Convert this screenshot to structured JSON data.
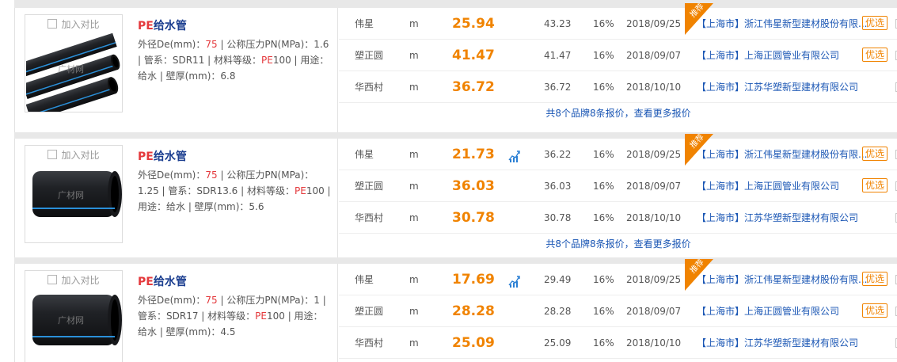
{
  "colors": {
    "price": "#f08300",
    "link": "#1a56b4",
    "highlight": "#e4393c",
    "recommend_badge": "#f08300"
  },
  "products": [
    {
      "compare_label": "加入对比",
      "title_prefix": "PE",
      "title_rest": "给水管",
      "image_watermark": "广材网",
      "specs": {
        "od_label": "外径De(mm)：",
        "od_value": "75",
        "pn_label": " | 公称压力PN(MPa)：1.6 | ",
        "sdr_label": "管系：SDR11 | 材料等级：",
        "material": "PE",
        "tail": "100 | 用途：给水 | 壁厚(mm)：6.8"
      },
      "rows": [
        {
          "brand": "伟星",
          "unit": "m",
          "price": "25.94",
          "trend_icon": false,
          "ref_price": "43.23",
          "tax": "16%",
          "date": "2018/09/25",
          "region": "【上海市】",
          "supplier": "浙江伟星新型建材股份有限...",
          "preferred": "优选",
          "recommended": true
        },
        {
          "brand": "塑正圆",
          "unit": "m",
          "price": "41.47",
          "trend_icon": false,
          "ref_price": "41.47",
          "tax": "16%",
          "date": "2018/09/07",
          "region": "【上海市】",
          "supplier": "上海正圆管业有限公司",
          "preferred": "优选",
          "recommended": false
        },
        {
          "brand": "华西村",
          "unit": "m",
          "price": "36.72",
          "trend_icon": false,
          "ref_price": "36.72",
          "tax": "16%",
          "date": "2018/10/10",
          "region": "【上海市】",
          "supplier": "江苏华塑新型建材有限公司",
          "preferred": "",
          "recommended": false
        }
      ],
      "more_text": "共8个品牌8条报价，查看更多报价"
    },
    {
      "compare_label": "加入对比",
      "title_prefix": "PE",
      "title_rest": "给水管",
      "image_watermark": "广材网",
      "specs": {
        "od_label": "外径De(mm)：",
        "od_value": "75",
        "pn_label": " | 公称压力PN(MPa)：1.25 | ",
        "sdr_label": "管系：SDR13.6 | 材料等级：",
        "material": "PE",
        "tail": "100 | 用途：给水 | 壁厚(mm)：5.6"
      },
      "rows": [
        {
          "brand": "伟星",
          "unit": "m",
          "price": "21.73",
          "trend_icon": true,
          "ref_price": "36.22",
          "tax": "16%",
          "date": "2018/09/25",
          "region": "【上海市】",
          "supplier": "浙江伟星新型建材股份有限...",
          "preferred": "优选",
          "recommended": true
        },
        {
          "brand": "塑正圆",
          "unit": "m",
          "price": "36.03",
          "trend_icon": false,
          "ref_price": "36.03",
          "tax": "16%",
          "date": "2018/09/07",
          "region": "【上海市】",
          "supplier": "上海正圆管业有限公司",
          "preferred": "优选",
          "recommended": false
        },
        {
          "brand": "华西村",
          "unit": "m",
          "price": "30.78",
          "trend_icon": false,
          "ref_price": "30.78",
          "tax": "16%",
          "date": "2018/10/10",
          "region": "【上海市】",
          "supplier": "江苏华塑新型建材有限公司",
          "preferred": "",
          "recommended": false
        }
      ],
      "more_text": "共8个品牌8条报价，查看更多报价"
    },
    {
      "compare_label": "加入对比",
      "title_prefix": "PE",
      "title_rest": "给水管",
      "image_watermark": "广材网",
      "specs": {
        "od_label": "外径De(mm)：",
        "od_value": "75",
        "pn_label": " | 公称压力PN(MPa)：1 | ",
        "sdr_label": "管系：SDR17 | 材料等级：",
        "material": "PE",
        "tail": "100 | 用途：给水 | 壁厚(mm)：4.5"
      },
      "rows": [
        {
          "brand": "伟星",
          "unit": "m",
          "price": "17.69",
          "trend_icon": true,
          "ref_price": "29.49",
          "tax": "16%",
          "date": "2018/09/25",
          "region": "【上海市】",
          "supplier": "浙江伟星新型建材股份有限...",
          "preferred": "优选",
          "recommended": true
        },
        {
          "brand": "塑正圆",
          "unit": "m",
          "price": "28.28",
          "trend_icon": false,
          "ref_price": "28.28",
          "tax": "16%",
          "date": "2018/09/07",
          "region": "【上海市】",
          "supplier": "上海正圆管业有限公司",
          "preferred": "优选",
          "recommended": false
        },
        {
          "brand": "华西村",
          "unit": "m",
          "price": "25.09",
          "trend_icon": false,
          "ref_price": "25.09",
          "tax": "16%",
          "date": "2018/10/10",
          "region": "【上海市】",
          "supplier": "江苏华塑新型建材有限公司",
          "preferred": "",
          "recommended": false
        }
      ],
      "more_text": ""
    }
  ],
  "recommend_label": "推荐"
}
